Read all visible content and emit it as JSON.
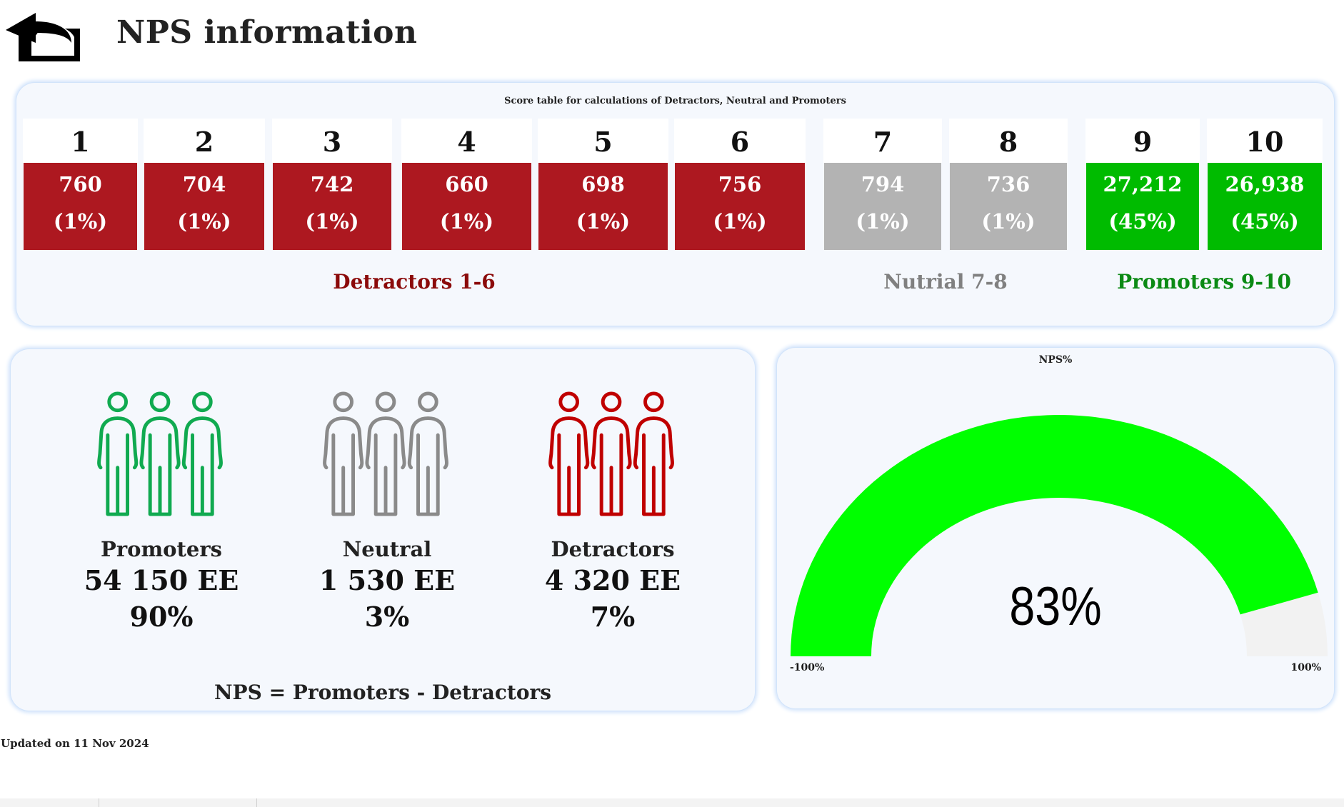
{
  "header": {
    "back_icon": "reply-arrow-icon",
    "title": "NPS information"
  },
  "score_table": {
    "title": "Score table for calculations of Detractors, Neutral and Promoters",
    "columns": [
      {
        "score": "1",
        "count": "760",
        "percent": "(1%)",
        "group": "detractor"
      },
      {
        "score": "2",
        "count": "704",
        "percent": "(1%)",
        "group": "detractor"
      },
      {
        "score": "3",
        "count": "742",
        "percent": "(1%)",
        "group": "detractor"
      },
      {
        "score": "4",
        "count": "660",
        "percent": "(1%)",
        "group": "detractor"
      },
      {
        "score": "5",
        "count": "698",
        "percent": "(1%)",
        "group": "detractor"
      },
      {
        "score": "6",
        "count": "756",
        "percent": "(1%)",
        "group": "detractor"
      },
      {
        "score": "7",
        "count": "794",
        "percent": "(1%)",
        "group": "neutral"
      },
      {
        "score": "8",
        "count": "736",
        "percent": "(1%)",
        "group": "neutral"
      },
      {
        "score": "9",
        "count": "27,212",
        "percent": "(45%)",
        "group": "promoter"
      },
      {
        "score": "10",
        "count": "26,938",
        "percent": "(45%)",
        "group": "promoter"
      }
    ],
    "group_labels": {
      "detractors": "Detractors 1-6",
      "neutral": "Nutrial 7-8",
      "promoters": "Promoters 9-10"
    }
  },
  "segments": [
    {
      "key": "promoters",
      "icon": "people-group-icon",
      "label": "Promoters",
      "count": "54 150 EE",
      "percent": "90%"
    },
    {
      "key": "neutral",
      "icon": "people-group-icon",
      "label": "Neutral",
      "count": "1 530 EE",
      "percent": "3%"
    },
    {
      "key": "detractors",
      "icon": "people-group-icon",
      "label": "Detractors",
      "count": "4 320 EE",
      "percent": "7%"
    }
  ],
  "formula": "NPS = Promoters - Detractors",
  "gauge": {
    "title": "NPS%",
    "value": 83,
    "value_label": "83%",
    "min": -100,
    "max": 100,
    "min_label": "-100%",
    "max_label": "100%"
  },
  "colors": {
    "detractor": "#ad1820",
    "neutral": "#b3b3b3",
    "promoter": "#00bb00",
    "detractor_label": "#8b0a0a",
    "neutral_label": "#808080",
    "promoter_label": "#0b8a14",
    "icon_promoter": "#10aa50",
    "icon_neutral": "#8a8a8a",
    "icon_detractor": "#c00000",
    "gauge_fill": "#00ff00",
    "gauge_track": "#f2f2f2"
  },
  "footer": {
    "updated": "Updated on 11 Nov 2024"
  }
}
